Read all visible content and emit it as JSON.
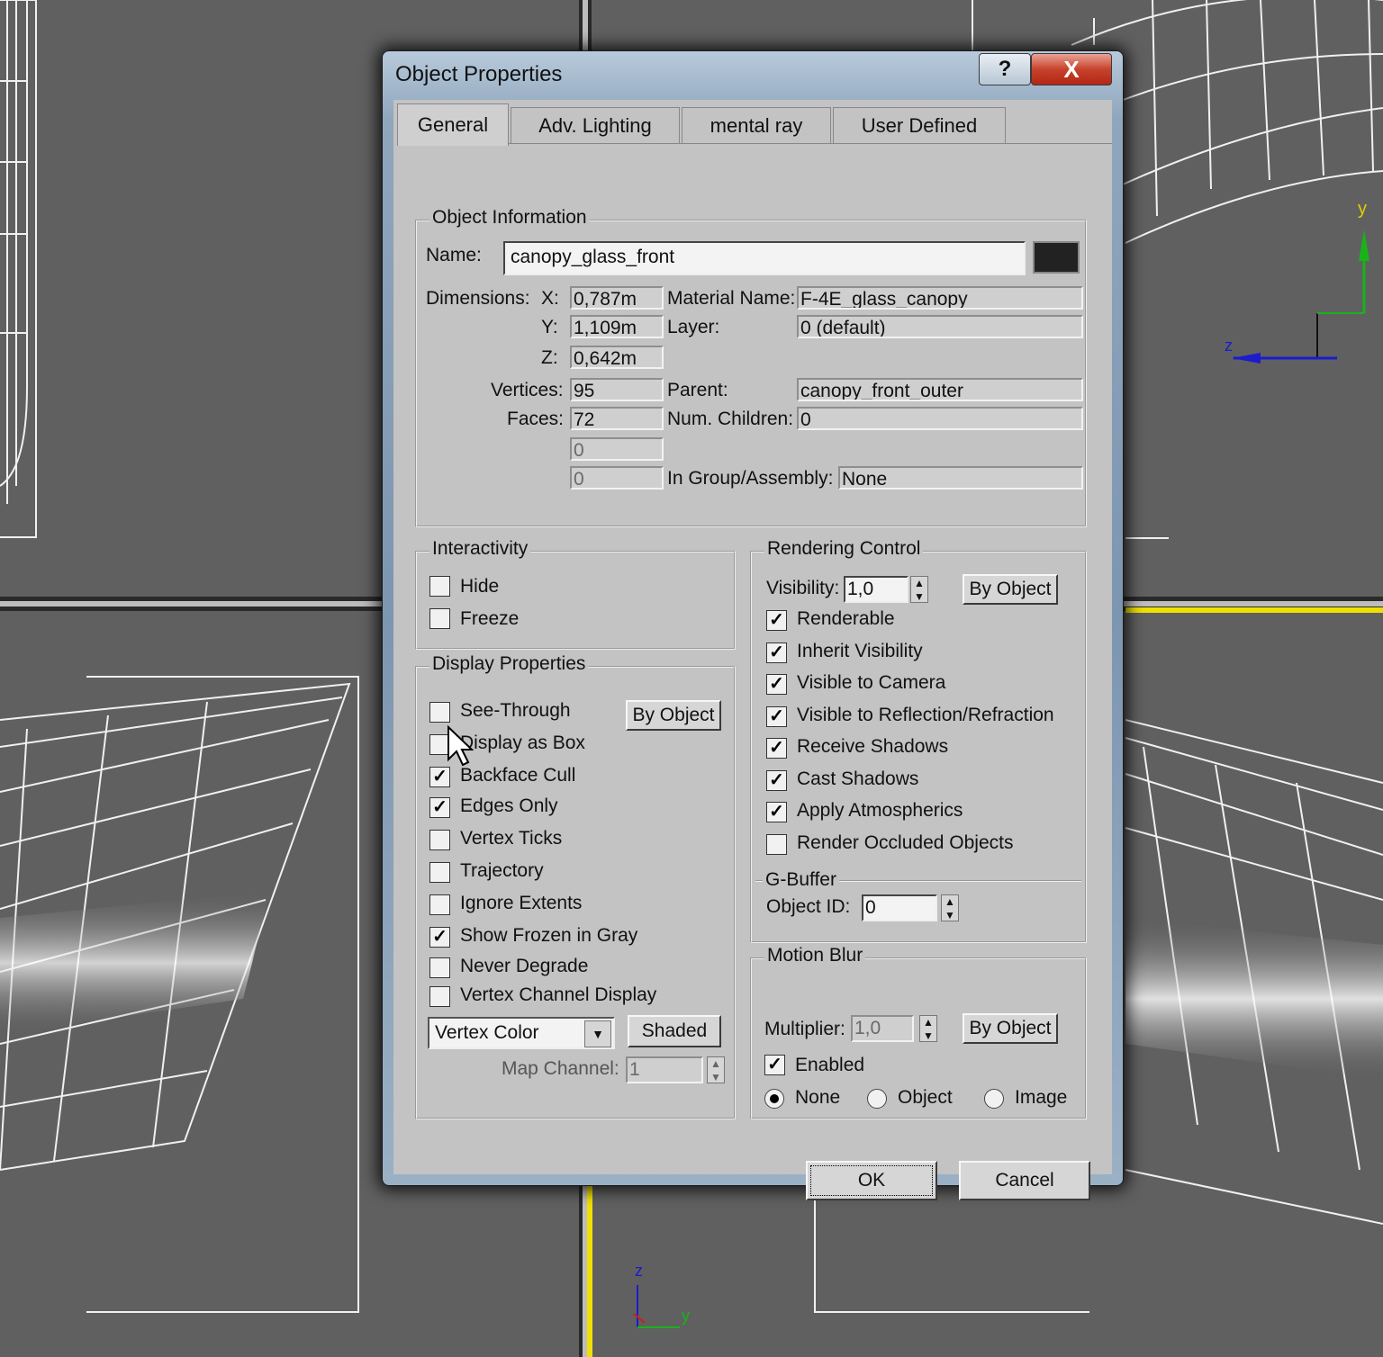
{
  "dialog": {
    "title": "Object Properties",
    "help_label": "?",
    "close_label": "X",
    "tabs": [
      {
        "label": "General",
        "active": true
      },
      {
        "label": "Adv. Lighting",
        "active": false
      },
      {
        "label": "mental ray",
        "active": false
      },
      {
        "label": "User Defined",
        "active": false
      }
    ],
    "object_info": {
      "group_label": "Object Information",
      "name_label": "Name:",
      "name_value": "canopy_glass_front",
      "color_swatch": "#222222",
      "dimensions_label": "Dimensions:",
      "x_label": "X:",
      "x_value": "0,787m",
      "y_label": "Y:",
      "y_value": "1,109m",
      "z_label": "Z:",
      "z_value": "0,642m",
      "vertices_label": "Vertices:",
      "vertices_value": "95",
      "faces_label": "Faces:",
      "faces_value": "72",
      "extra1_value": "0",
      "extra2_value": "0",
      "material_label": "Material Name:",
      "material_value": "F-4E_glass_canopy",
      "layer_label": "Layer:",
      "layer_value": "0 (default)",
      "parent_label": "Parent:",
      "parent_value": "canopy_front_outer",
      "children_label": "Num. Children:",
      "children_value": "0",
      "group_asm_label": "In Group/Assembly:",
      "group_asm_value": "None"
    },
    "interactivity": {
      "group_label": "Interactivity",
      "hide_label": "Hide",
      "hide_checked": false,
      "freeze_label": "Freeze",
      "freeze_checked": false
    },
    "display": {
      "group_label": "Display Properties",
      "by_object_label": "By Object",
      "items": [
        {
          "label": "See-Through",
          "checked": false
        },
        {
          "label": "Display as Box",
          "checked": false
        },
        {
          "label": "Backface Cull",
          "checked": true
        },
        {
          "label": "Edges Only",
          "checked": true
        },
        {
          "label": "Vertex Ticks",
          "checked": false
        },
        {
          "label": "Trajectory",
          "checked": false
        },
        {
          "label": "Ignore Extents",
          "checked": false
        },
        {
          "label": "Show Frozen in Gray",
          "checked": true
        },
        {
          "label": "Never Degrade",
          "checked": false
        },
        {
          "label": "Vertex Channel Display",
          "checked": false
        }
      ],
      "channel_combo_value": "Vertex Color",
      "shaded_label": "Shaded",
      "map_channel_label": "Map Channel:",
      "map_channel_value": "1"
    },
    "rendering": {
      "group_label": "Rendering Control",
      "visibility_label": "Visibility:",
      "visibility_value": "1,0",
      "by_object_label": "By Object",
      "items": [
        {
          "label": "Renderable",
          "checked": true
        },
        {
          "label": "Inherit Visibility",
          "checked": true
        },
        {
          "label": "Visible to Camera",
          "checked": true
        },
        {
          "label": "Visible to Reflection/Refraction",
          "checked": true
        },
        {
          "label": "Receive Shadows",
          "checked": true
        },
        {
          "label": "Cast Shadows",
          "checked": true
        },
        {
          "label": "Apply Atmospherics",
          "checked": true
        },
        {
          "label": "Render Occluded Objects",
          "checked": false
        }
      ],
      "gbuffer_label": "G-Buffer",
      "object_id_label": "Object ID:",
      "object_id_value": "0"
    },
    "motion_blur": {
      "group_label": "Motion Blur",
      "multiplier_label": "Multiplier:",
      "multiplier_value": "1,0",
      "by_object_label": "By Object",
      "enabled_label": "Enabled",
      "enabled_checked": true,
      "modes": [
        {
          "label": "None",
          "selected": true
        },
        {
          "label": "Object",
          "selected": false
        },
        {
          "label": "Image",
          "selected": false
        }
      ]
    },
    "ok_label": "OK",
    "cancel_label": "Cancel"
  },
  "viewport": {
    "axis_top_right": {
      "y": "y",
      "z": "z"
    },
    "axis_bottom": {
      "z": "z",
      "y": "y"
    }
  },
  "colors": {
    "highlight_line": "#f0e000",
    "axis_y": "#19b219",
    "axis_z": "#1c1ccc",
    "close_button": "#c7432d"
  }
}
